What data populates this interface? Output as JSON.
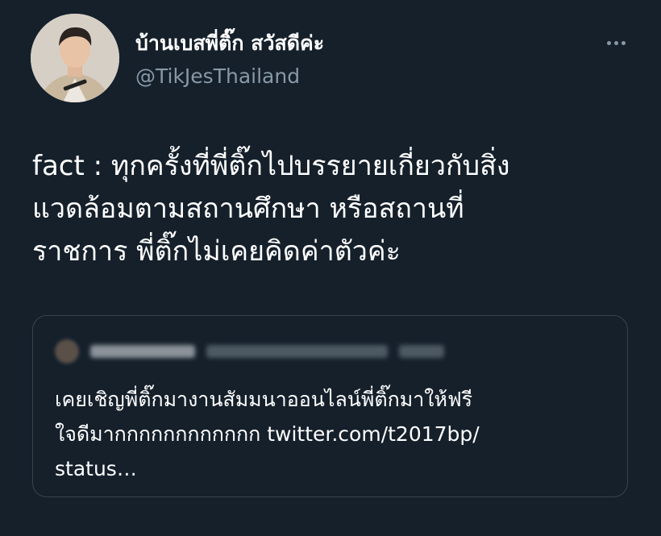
{
  "tweet": {
    "display_name": "บ้านเบสพี่ติ๊ก สวัสดีค่ะ",
    "handle": "@TikJesThailand",
    "text_lines": [
      "fact : ทุกครั้งที่พี่ติ๊กไปบรรยายเกี่ยวกับสิ่ง",
      "แวดล้อมตามสถานศึกษา หรือสถานที่",
      "ราชการ พี่ติ๊กไม่เคยคิดค่าตัวค่ะ"
    ],
    "more_icon": "more-horizontal-icon"
  },
  "quoted_tweet": {
    "text_lines": [
      "เคยเชิญพี่ติ๊กมางานสัมมนาออนไลน์พี่ติ๊กมาให้ฟรี",
      "ใจดีมากกกกกกกกกกกก twitter.com/t2017bp/",
      "status…"
    ]
  },
  "colors": {
    "background": "#15202b",
    "text": "#ffffff",
    "secondary_text": "#8899a6",
    "border": "#38444d"
  }
}
